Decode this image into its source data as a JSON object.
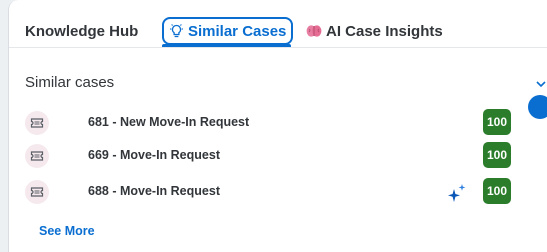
{
  "tabs": [
    {
      "label": "Knowledge Hub",
      "active": false
    },
    {
      "label": "Similar Cases",
      "active": true,
      "icon": "lightbulb-icon"
    },
    {
      "label": "AI Case Insights",
      "active": false,
      "icon": "brain-icon"
    }
  ],
  "section": {
    "title": "Similar cases",
    "collapse_icon": "chevron-down-icon"
  },
  "cases": [
    {
      "label": "681 - New Move-In Request",
      "score": "100",
      "icon": "ticket-icon"
    },
    {
      "label": "669 - Move-In Request",
      "score": "100",
      "icon": "ticket-icon"
    },
    {
      "label": "688 - Move-In Request",
      "score": "100",
      "icon": "ticket-icon",
      "ai_sparkle": true
    }
  ],
  "see_more_label": "See More",
  "colors": {
    "accent": "#0a6ed1",
    "score_badge": "#2b7d2b",
    "text": "#32363a",
    "ticket_bg": "#f5e9ed"
  }
}
